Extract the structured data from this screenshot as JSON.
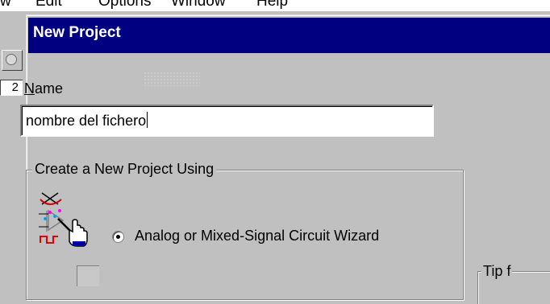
{
  "background_app": {
    "menu_items": [
      "w",
      "Edit",
      "Options",
      "Window",
      "Help"
    ],
    "field_value": "2"
  },
  "dialog": {
    "title": "New Project",
    "name_label_accel": "N",
    "name_label_rest": "ame",
    "name_value": "nombre del fichero",
    "group_title": "Create a New Project Using",
    "option_label": "Analog or Mixed-Signal Circuit Wizard",
    "option_selected": true,
    "tip_label": "Tip f"
  },
  "colors": {
    "titlebar": "#000080",
    "face": "#c0c0c0",
    "input_bg": "#ffffff"
  },
  "icons": {
    "wizard": "circuit-wizard-icon",
    "toolbar": "toolbar-icon",
    "option2": "option-icon"
  }
}
